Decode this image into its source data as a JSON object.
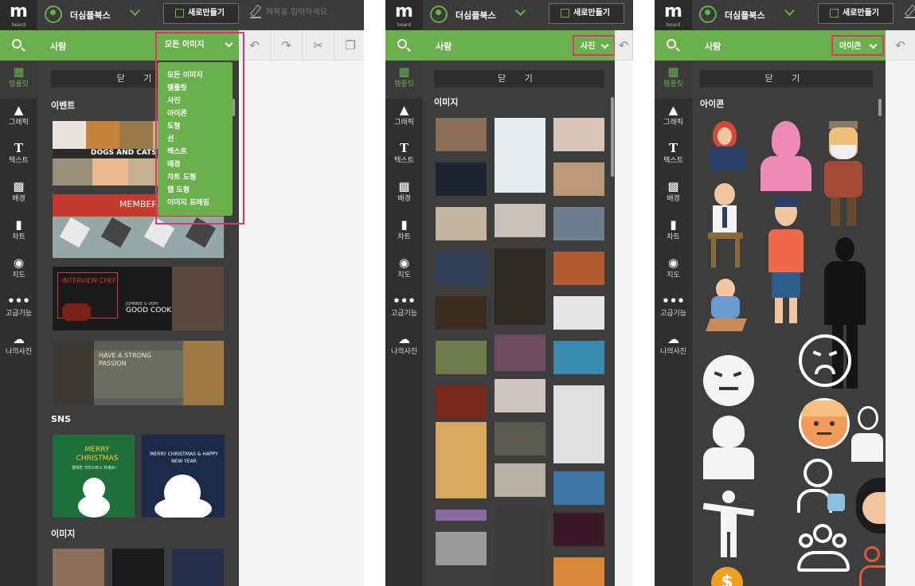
{
  "app": {
    "logo": "m",
    "logo_sub": "board",
    "brand": "더심플북스",
    "new_button": "새로만들기",
    "title_placeholder": "제목을 입력하세요"
  },
  "sidebar": {
    "items": [
      {
        "label": "템플릿",
        "icon": "template-icon"
      },
      {
        "label": "그래픽",
        "icon": "graphic-icon"
      },
      {
        "label": "텍스트",
        "icon": "text-icon"
      },
      {
        "label": "배경",
        "icon": "background-icon"
      },
      {
        "label": "차트",
        "icon": "chart-icon"
      },
      {
        "label": "지도",
        "icon": "map-pin-icon"
      },
      {
        "label": "고급기능",
        "icon": "more-icon"
      },
      {
        "label": "나의사진",
        "icon": "upload-cloud-icon"
      }
    ]
  },
  "search_title": "사람",
  "close_label": "닫 기",
  "panel1": {
    "filter_value": "모든 이미지",
    "dropdown_options": [
      "모든 이미지",
      "템플릿",
      "사진",
      "아이콘",
      "도형",
      "선",
      "텍스트",
      "배경",
      "차트 도형",
      "맵 도형",
      "이미지 프레임"
    ],
    "sections": {
      "event": "이벤트",
      "sns": "SNS",
      "image": "이미지"
    },
    "templates": {
      "dogs_cats": "DOGS AND CATS AND",
      "member": "MEMBER",
      "interview": "INTERVIEW CHEF",
      "good_cook": "GOOD COOK",
      "good_cook_sub": "JOHNNIE & VERY",
      "strong": "HAVE A STRONG PASSION",
      "merry1": "MERRY CHRISTMAS",
      "merry1_sub": "행복한 크리스마스 되세요!",
      "merry2": "MERRY CHRISTMAS & HAPPY NEW YEAR"
    }
  },
  "panel2": {
    "filter_value": "사진",
    "section": "이미지"
  },
  "panel3": {
    "filter_value": "아이콘",
    "section": "아이콘"
  },
  "colors": {
    "accent": "#6ab04c",
    "highlight": "#e2346e",
    "topbar": "#3b3b3b",
    "panel": "#3d3d3d"
  }
}
